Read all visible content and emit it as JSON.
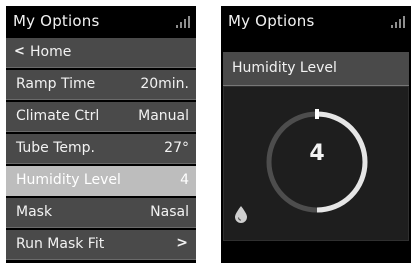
{
  "left_screen": {
    "title": "My Options",
    "menu": [
      {
        "label": "Home",
        "value": "",
        "type": "back"
      },
      {
        "label": "Ramp Time",
        "value": "20min.",
        "type": "value"
      },
      {
        "label": "Climate Ctrl",
        "value": "Manual",
        "type": "value"
      },
      {
        "label": "Tube Temp.",
        "value": "27°",
        "type": "value"
      },
      {
        "label": "Humidity Level",
        "value": "4",
        "type": "value",
        "selected": true
      },
      {
        "label": "Mask",
        "value": "Nasal",
        "type": "value"
      },
      {
        "label": "Run Mask Fit",
        "value": "",
        "type": "submenu"
      }
    ]
  },
  "right_screen": {
    "title": "My Options",
    "panel_title": "Humidity Level",
    "gauge_value": "4",
    "gauge_fraction": 0.5
  },
  "icons": {
    "signal": "signal-strength-icon",
    "back": "chevron-left-icon",
    "submenu": "chevron-right-icon",
    "humidity": "water-drop-icon"
  },
  "colors": {
    "background": "#000000",
    "menu_item": "#4a4a4a",
    "menu_selected": "#bdbdbd",
    "gauge_track": "#4d4d4d",
    "gauge_fill": "#e6e6e6"
  }
}
